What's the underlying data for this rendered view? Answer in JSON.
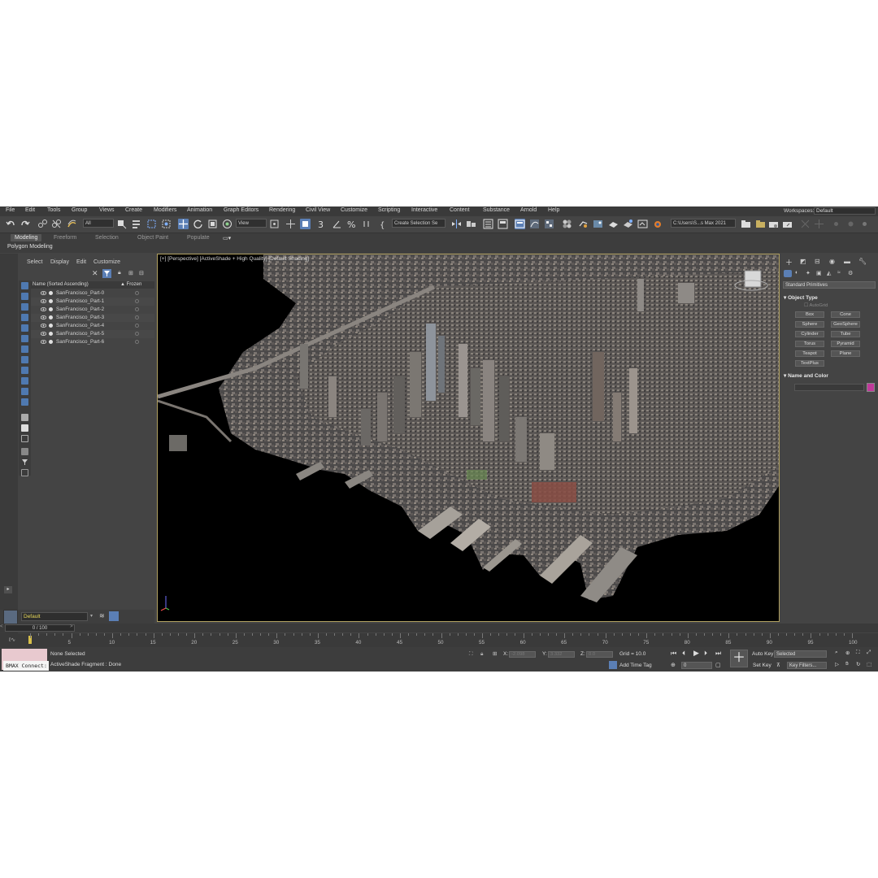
{
  "menu": [
    "File",
    "Edit",
    "Tools",
    "Group",
    "Views",
    "Create",
    "Modifiers",
    "Animation",
    "Graph Editors",
    "Rendering",
    "Civil View",
    "Customize",
    "Scripting",
    "Interactive",
    "Content",
    "Substance",
    "Arnold",
    "Help"
  ],
  "workspace": {
    "label": "Workspaces:",
    "value": "Default"
  },
  "toolbar": {
    "filter_value": "All",
    "view_value": "View",
    "selection_set_value": "Create Selection Se",
    "project_path": "C:\\Users\\S...s Max 2021"
  },
  "ribbon": {
    "tabs": [
      "Modeling",
      "Freeform",
      "Selection",
      "Object Paint",
      "Populate"
    ],
    "sub_label": "Polygon Modeling"
  },
  "explorer": {
    "menus": [
      "Select",
      "Display",
      "Edit",
      "Customize"
    ],
    "column_name": "Name (Sorted Ascending)",
    "column_frozen": "▲ Frozen",
    "objects": [
      "SanFrancisco_Part-0",
      "SanFrancisco_Part-1",
      "SanFrancisco_Part-2",
      "SanFrancisco_Part-3",
      "SanFrancisco_Part-4",
      "SanFrancisco_Part-5",
      "SanFrancisco_Part-6"
    ],
    "layer": "Default"
  },
  "viewport": {
    "label": "[+] [Perspective] [ActiveShade + High Quality] [Default Shading]"
  },
  "command_panel": {
    "category": "Standard Primitives",
    "object_type_title": "Object Type",
    "autogrid": "AutoGrid",
    "buttons": [
      "Box",
      "Cone",
      "Sphere",
      "GeoSphere",
      "Cylinder",
      "Tube",
      "Torus",
      "Pyramid",
      "Teapot",
      "Plane",
      "TextPlus"
    ],
    "name_color_title": "Name and Color",
    "swatch_color": "#c0399a"
  },
  "timeline": {
    "frame_display": "0 / 100",
    "ticks": [
      "5",
      "10",
      "15",
      "20",
      "25",
      "30",
      "35",
      "40",
      "45",
      "50",
      "55",
      "60",
      "65",
      "70",
      "75",
      "80",
      "85",
      "90",
      "95",
      "100"
    ]
  },
  "status": {
    "maxscript": "BMAX Connect:",
    "selection": "None Selected",
    "prompt": "ActiveShade Fragment : Done",
    "x_label": "X:",
    "x_value": "-2.098",
    "y_label": "Y:",
    "y_value": "3.332",
    "z_label": "Z:",
    "z_value": "0.0",
    "grid": "Grid = 10.0",
    "add_time_tag": "Add Time Tag",
    "auto_key": "Auto Key",
    "selected": "Selected",
    "set_key": "Set Key",
    "key_filters": "Key Filters...",
    "frame": "0"
  }
}
